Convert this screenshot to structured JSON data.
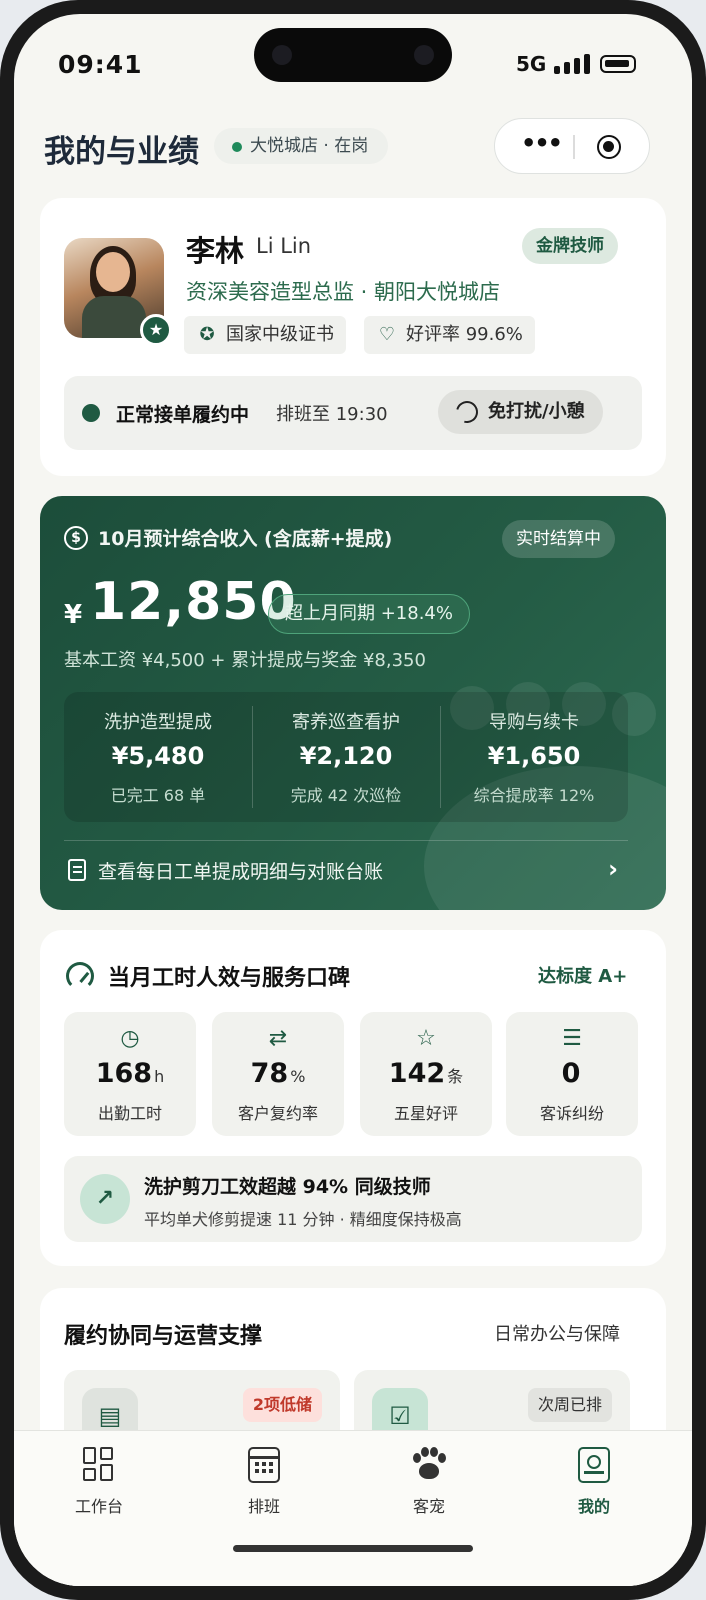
{
  "status_bar": {
    "time": "09:41",
    "network": "5G"
  },
  "header": {
    "title": "我的与业绩",
    "store_status": "大悦城店 · 在岗"
  },
  "profile": {
    "name": "李林",
    "name_en": "Li Lin",
    "level_badge": "金牌技师",
    "role": "资深美容造型总监 · 朝阳大悦城店",
    "tags": [
      {
        "icon": "certificate-icon",
        "label": "国家中级证书"
      },
      {
        "icon": "heart-icon",
        "label": "好评率 99.6%"
      }
    ],
    "duty": {
      "status": "正常接单履约中",
      "schedule": "排班至 19:30",
      "dnd_label": "免打扰/小憩"
    }
  },
  "income": {
    "title": "10月预计综合收入 (含底薪+提成)",
    "settle_status": "实时结算中",
    "currency": "¥",
    "amount": "12,850",
    "growth": "超上月同期 +18.4%",
    "breakdown": "基本工资 ¥4,500 + 累计提成与奖金 ¥8,350",
    "stats": [
      {
        "label": "洗护造型提成",
        "value": "¥5,480",
        "sub": "已完工 68 单"
      },
      {
        "label": "寄养巡查看护",
        "value": "¥2,120",
        "sub": "完成 42 次巡检"
      },
      {
        "label": "导购与续卡",
        "value": "¥1,650",
        "sub": "综合提成率 12%"
      }
    ],
    "link_label": "查看每日工单提成明细与对账台账"
  },
  "performance": {
    "title": "当月工时人效与服务口碑",
    "grade": "达标度 A+",
    "metrics": [
      {
        "icon": "clock-icon",
        "value": "168",
        "unit": "h",
        "label": "出勤工时"
      },
      {
        "icon": "repeat-icon",
        "value": "78",
        "unit": "%",
        "label": "客户复约率"
      },
      {
        "icon": "star-icon",
        "value": "142",
        "unit": "条",
        "label": "五星好评"
      },
      {
        "icon": "complaint-icon",
        "value": "0",
        "unit": "",
        "label": "客诉纠纷"
      }
    ],
    "insight": {
      "title": "洗护剪刀工效超越 94% 同级技师",
      "sub": "平均单犬修剪提速 11 分钟 · 精细度保持极高"
    }
  },
  "operations": {
    "title": "履约协同与运营支撑",
    "sub": "日常办公与保障",
    "tiles": [
      {
        "icon": "archive-icon",
        "badge": "2项低储"
      },
      {
        "icon": "calendar-check-icon",
        "badge": "次周已排"
      }
    ]
  },
  "tabbar": {
    "items": [
      {
        "label": "工作台"
      },
      {
        "label": "排班"
      },
      {
        "label": "客宠"
      },
      {
        "label": "我的"
      }
    ],
    "active_index": 3
  }
}
